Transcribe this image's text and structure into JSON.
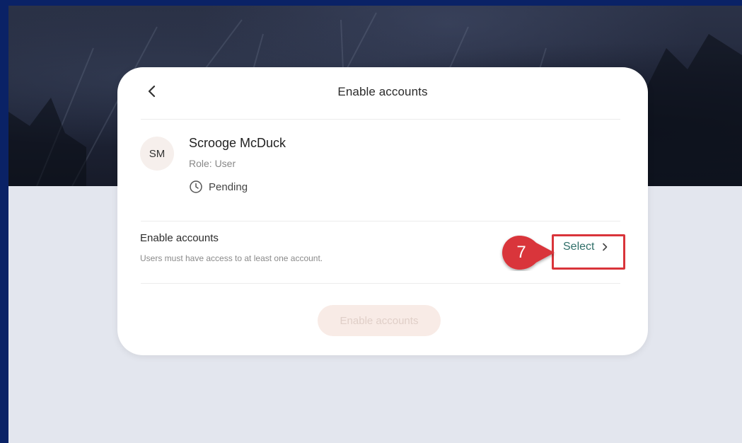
{
  "card": {
    "title": "Enable accounts"
  },
  "user": {
    "initials": "SM",
    "name": "Scrooge McDuck",
    "role": "Role: User",
    "status": "Pending"
  },
  "section": {
    "title": "Enable accounts",
    "description": "Users must have access to at least one account.",
    "select_label": "Select"
  },
  "annotation": {
    "step_number": "7",
    "color": "#d9343a"
  },
  "actions": {
    "enable_label": "Enable accounts",
    "enabled": false
  },
  "icons": {
    "back": "chevron-left-icon",
    "status": "clock-icon",
    "select": "chevron-right-icon"
  },
  "colors": {
    "link": "#2f6f69",
    "page_bg": "#e3e6ee",
    "outer_bg": "#0a2266"
  }
}
